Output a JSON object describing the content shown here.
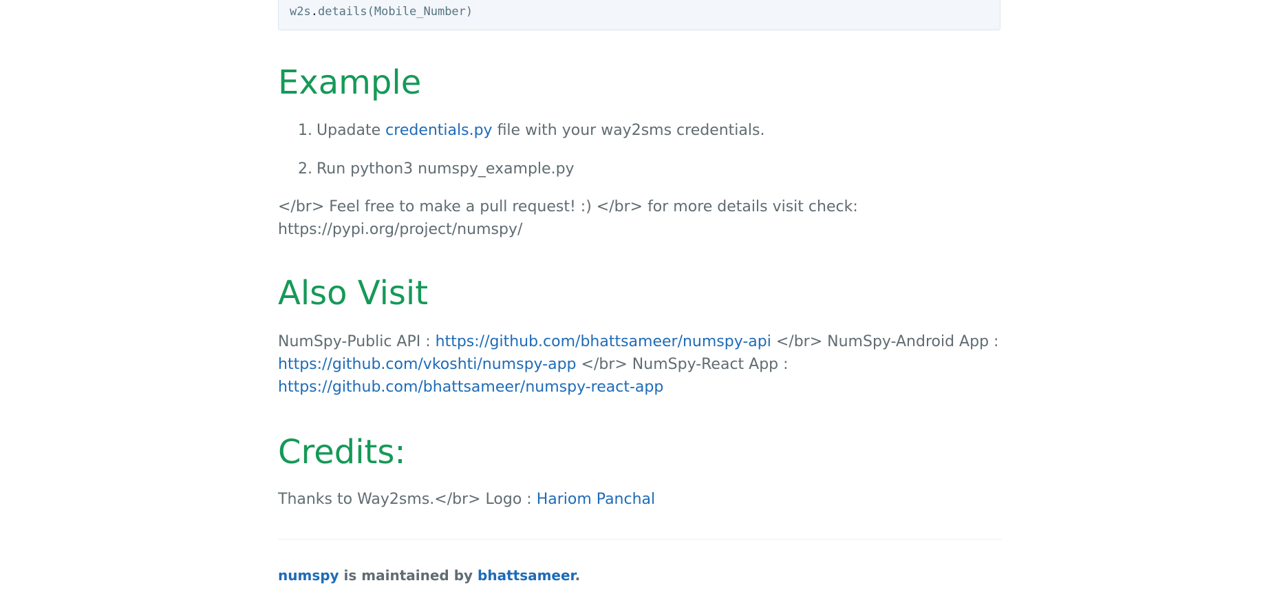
{
  "code": {
    "object": "w2s",
    "dot": ".",
    "call": "details(Mobile_Number)"
  },
  "example": {
    "heading": "Example",
    "steps": [
      {
        "number": "1.",
        "prefix": "Upadate ",
        "link": "credentials.py",
        "suffix": " file with your way2sms credentials."
      },
      {
        "number": "2.",
        "text": "Run python3 numspy_example.py"
      }
    ],
    "note_line1": "</br> Feel free to make a pull request! :) </br> for more details visit check:",
    "note_line2": "https://pypi.org/project/numspy/"
  },
  "also_visit": {
    "heading": "Also Visit",
    "public_api_label": "NumSpy-Public API : ",
    "public_api_link": "https://github.com/bhattsameer/numspy-api",
    "android_label": " </br> NumSpy-Android App :",
    "android_link": "https://github.com/vkoshti/numspy-app",
    "react_label": " </br> NumSpy-React App :",
    "react_link": "https://github.com/bhattsameer/numspy-react-app"
  },
  "credits": {
    "heading": "Credits:",
    "text": "Thanks to Way2sms.</br> Logo : ",
    "link": "Hariom Panchal"
  },
  "footer": {
    "project_link": "numspy",
    "middle": " is maintained by ",
    "author_link": "bhattsameer",
    "end": "."
  },
  "colors": {
    "heading": "#159957",
    "link": "#1e6bb8",
    "text": "#606c71",
    "code_bg": "#f3f6fa"
  }
}
